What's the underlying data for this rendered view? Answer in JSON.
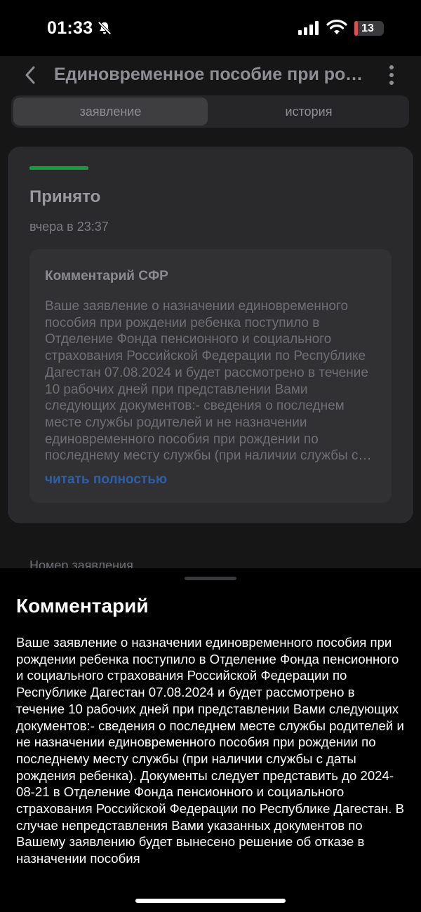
{
  "status_bar": {
    "time": "01:33",
    "battery_level": 13,
    "battery_text": "13"
  },
  "header": {
    "title": "Единовременное пособие при рождении ребенка"
  },
  "tabs": [
    {
      "label": "заявление",
      "active": true
    },
    {
      "label": "история",
      "active": false
    }
  ],
  "status_card": {
    "status": "Принято",
    "timestamp": "вчера в 23:37",
    "accent_color": "#1a9a45",
    "comment_heading": "Комментарий СФР",
    "comment_preview": "Ваше заявление о назначении единовременного пособия при рождении ребенка поступило в Отделение Фонда пенсионного и социального страхования Российской Федерации по Республике Дагестан 07.08.2024 и будет рассмотрено в течение 10 рабочих дней при представлении Вами следующих документов:- сведения о последнем месте службы родителей и не назначении единовременного пособия при рождении по последнему месту службы (при наличии службы с даты рождения ребенка).",
    "read_more": "читать полностью"
  },
  "application_number_label": "Номер заявления",
  "sheet": {
    "title": "Комментарий",
    "text": "Ваше заявление о назначении единовременного пособия при рождении ребенка поступило в Отделение Фонда пенсионного и социального страхования Российской Федерации по Республике Дагестан 07.08.2024 и будет рассмотрено в течение 10 рабочих дней при представлении Вами следующих документов:- сведения о последнем месте службы родителей и не назначении единовременного пособия при рождении по последнему месту службы (при наличии службы с даты рождения ребенка). Документы следует представить до 2024-08-21 в Отделение Фонда пенсионного и социального страхования Российской Федерации по Республике Дагестан. В случае непредставления Вами указанных документов по Вашему заявлению будет вынесено решение об отказе в назначении пособия"
  },
  "icons": {
    "bell": "bell-slash-icon",
    "signal": "cellular-signal-icon",
    "wifi": "wifi-icon",
    "back": "chevron-left-icon",
    "more": "more-vertical-icon"
  }
}
